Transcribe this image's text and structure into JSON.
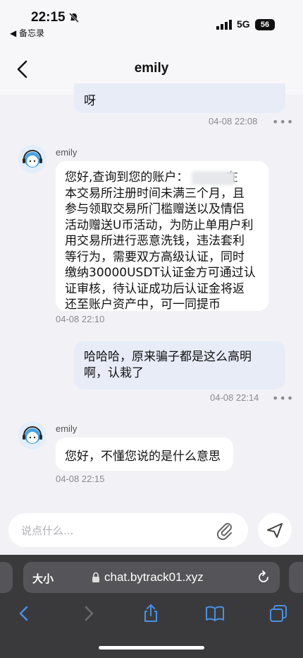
{
  "status": {
    "time": "22:15",
    "back_app": "◀ 备忘录",
    "network": "5G",
    "battery": "56"
  },
  "nav": {
    "title": "emily"
  },
  "messages": [
    {
      "text": "呀",
      "time": "04-08 22:08"
    },
    {
      "sender": "emily",
      "lines": [
        "您好,查询到您的账户：      .在",
        "本交易所注册时间未满三个月，且",
        "参与领取交易所门槛赠送以及情侣",
        "活动赠送U币活动，为防止单用户利",
        "用交易所进行恶意洗钱，违法套利",
        "等行为，需要双方高级认证，同时",
        "缴纳30000USDT认证金方可通过认",
        "证审核，待认证成功后认证金将返",
        "还至账户资产中，可一同提币"
      ],
      "time": "04-08 22:10"
    },
    {
      "lines": [
        "哈哈哈，原来骗子都是这么高明",
        "啊，认栽了"
      ],
      "time": "04-08 22:14"
    },
    {
      "sender": "emily",
      "text": "您好，不懂您说的是什么意思",
      "time": "04-08 22:15"
    }
  ],
  "more": "•••",
  "input": {
    "placeholder": "说点什么..."
  },
  "browser": {
    "text_size": "大小",
    "url": "chat.bytrack01.xyz"
  },
  "colors": {
    "bubble_me": "#e7ecf7",
    "bubble_other": "#ffffff",
    "browser_bar": "#3a3a3d",
    "accent": "#4a90e2"
  }
}
